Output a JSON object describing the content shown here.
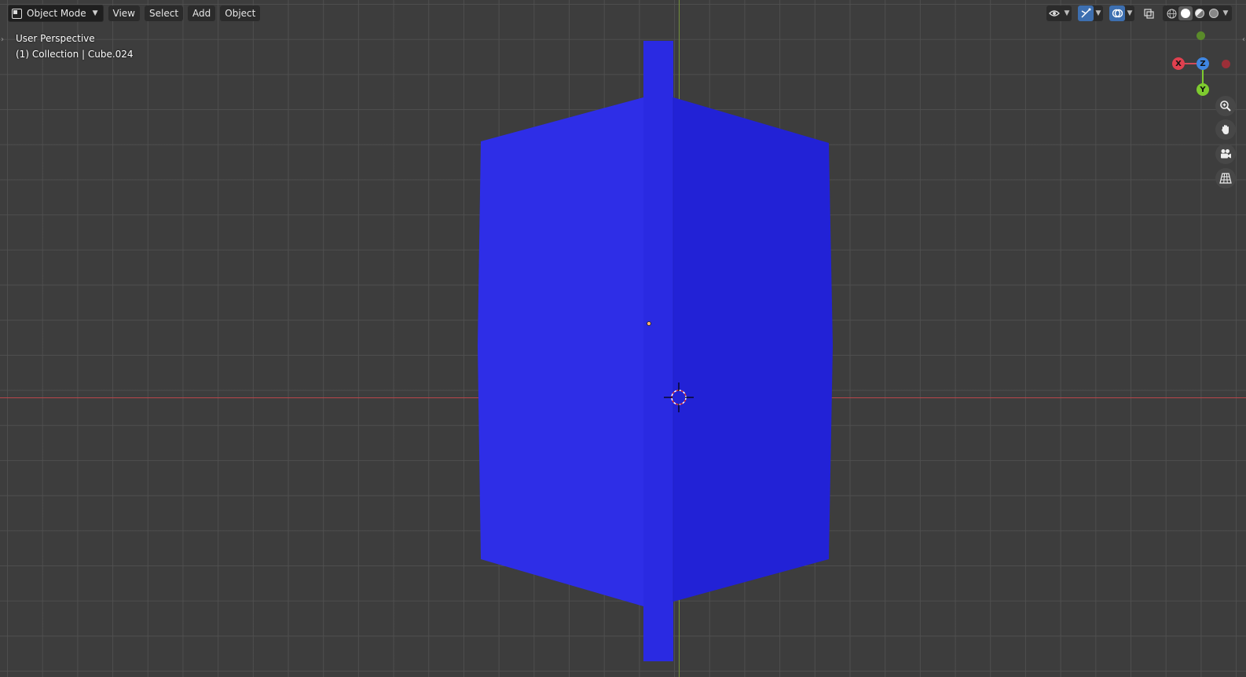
{
  "header": {
    "mode_label": "Object Mode",
    "menus": [
      "View",
      "Select",
      "Add",
      "Object"
    ]
  },
  "overlay": {
    "perspective": "User Perspective",
    "collection": "(1) Collection | Cube.024"
  },
  "gizmo": {
    "x_label": "X",
    "y_label": "Y",
    "z_label": "Z",
    "x_color": "#e0404f",
    "y_color": "#7ecb2f",
    "z_color": "#3f86e2"
  },
  "navigation_icons": [
    "zoom-icon",
    "hand-pan-icon",
    "camera-icon",
    "grid-ortho-icon"
  ],
  "header_right_icons": [
    "visibility-icon",
    "gizmo-toggle-icon",
    "overlay-toggle-icon",
    "xray-icon",
    "wireframe-shading-icon",
    "solid-shading-icon",
    "material-shading-icon",
    "rendered-shading-icon"
  ],
  "colors": {
    "background": "#3d3d3d",
    "object_left": "#2f2fe6",
    "object_right": "#2424d8",
    "axis_x": "#b8464b",
    "axis_y": "#74913c"
  }
}
